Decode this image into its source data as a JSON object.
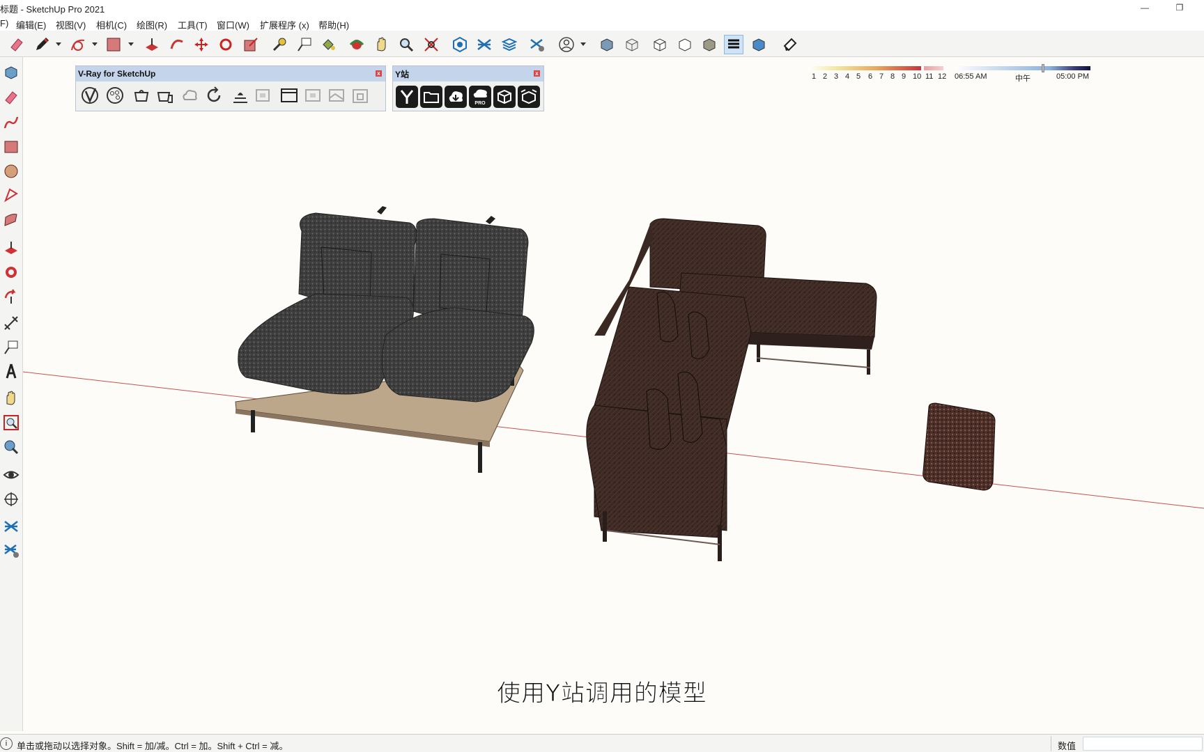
{
  "window": {
    "title": "标题 - SketchUp Pro 2021",
    "minimize_glyph": "—",
    "restore_glyph": "❐"
  },
  "menu": {
    "items": [
      {
        "label": "F)"
      },
      {
        "label": "编辑(E)"
      },
      {
        "label": "视图(V)"
      },
      {
        "label": "相机(C)"
      },
      {
        "label": "绘图(R)"
      },
      {
        "label": "工具(T)"
      },
      {
        "label": "窗口(W)"
      },
      {
        "label": "扩展程序 (x)"
      },
      {
        "label": "帮助(H)"
      }
    ]
  },
  "toolbar": {
    "icons": [
      "eraser-icon",
      "pencil-icon",
      "arc-icon",
      "rectangle-icon",
      "push-pull-icon",
      "follow-me-icon",
      "move-icon",
      "rotate-icon",
      "scale-icon",
      "tape-measure-icon",
      "text-icon",
      "paint-bucket-icon",
      "orbit-icon",
      "pan-icon",
      "zoom-icon",
      "zoom-extents-icon",
      "warehouse-icon",
      "extension-warehouse-icon",
      "layout-icon",
      "extension-manager-icon",
      "account-icon",
      "xray-style-icon",
      "wireframe-style-icon",
      "hidden-line-style-icon",
      "shaded-style-icon",
      "shaded-texture-style-icon",
      "monochrome-style-icon",
      "shadow-toggle-icon"
    ],
    "months": [
      "1",
      "2",
      "3",
      "4",
      "5",
      "6",
      "7",
      "8",
      "9",
      "10",
      "11",
      "12"
    ],
    "time_start": "06:55 AM",
    "time_mid": "中午",
    "time_end": "05:00 PM",
    "time_fraction": 0.64
  },
  "left_tools": [
    "select-icon",
    "eraser-icon",
    "freehand-icon",
    "rectangle-icon",
    "circle-icon",
    "arc-icon",
    "shape-icon",
    "push-pull-icon",
    "follow-me-icon",
    "rotate-icon",
    "dimension-icon",
    "text-icon",
    "axes-icon",
    "pan-icon",
    "zoom-window-icon",
    "zoom-icon",
    "look-around-icon",
    "walk-icon",
    "section-icon",
    "section-settings-icon"
  ],
  "vray_panel": {
    "title": "V-Ray for SketchUp",
    "close": "x",
    "buttons": [
      "asset-editor-icon",
      "material-icon",
      "render-icon",
      "interactive-render-icon",
      "render-cloud-icon",
      "refresh-icon",
      "lights-icon",
      "frame-buffer-icon",
      "viewport-render-icon",
      "batch-render-icon",
      "region-render-icon",
      "lock-icon"
    ]
  },
  "y_panel": {
    "title": "Y站",
    "close": "x",
    "buttons": [
      "y-logo-icon",
      "folder-icon",
      "cloud-download-icon",
      "pro-download-icon",
      "model-box-icon",
      "open-box-icon"
    ],
    "pro_label": "PRO"
  },
  "subtitle": "使用Y站调用的模型",
  "status": {
    "info": "i",
    "message": "单击或拖动以选择对象。Shift = 加/减。Ctrl = 加。Shift + Ctrl = 减。",
    "value_label": "数值",
    "value": ""
  },
  "colors": {
    "sofa_gray": "#3c3c3c",
    "sofa_brown": "#3e2a24",
    "ottoman": "#5a3a32",
    "axis_red": "#c85050",
    "panel_header": "#c4d4ea"
  }
}
